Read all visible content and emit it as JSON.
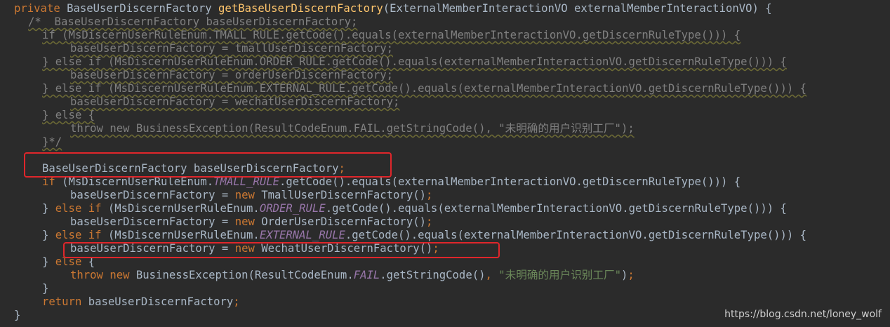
{
  "editor": {
    "language": "java",
    "theme": "darcula",
    "colors": {
      "background": "#2b2b2b",
      "keyword": "#cc7832",
      "method_declaration": "#ffc66d",
      "static_field": "#9876aa",
      "string": "#6a8759",
      "comment": "#808080",
      "plain": "#a9b7c6",
      "annotation_box": "#e0262b"
    },
    "lines": [
      {
        "indent": 1,
        "tokens": [
          [
            "kw",
            "private "
          ],
          [
            "text",
            "BaseUserDiscernFactory "
          ],
          [
            "fn",
            "getBaseUserDiscernFactory"
          ],
          [
            "text",
            "(ExternalMemberInteractionVO externalMemberInteractionVO) {"
          ]
        ]
      },
      {
        "indent": 2,
        "tokens": [
          [
            "cmt",
            "/*  BaseUserDiscernFactory baseUserDiscernFactory;"
          ]
        ]
      },
      {
        "indent": 3,
        "tokens": [
          [
            "cmt",
            "if (MsDiscernUserRuleEnum.TMALL_RULE.getCode().equals(externalMemberInteractionVO.getDiscernRuleType())) {"
          ]
        ]
      },
      {
        "indent": 5,
        "tokens": [
          [
            "cmt",
            "baseUserDiscernFactory = tmallUserDiscernFactory;"
          ]
        ]
      },
      {
        "indent": 3,
        "tokens": [
          [
            "cmt",
            "} else if (MsDiscernUserRuleEnum.ORDER_RULE.getCode().equals(externalMemberInteractionVO.getDiscernRuleType())) {"
          ]
        ]
      },
      {
        "indent": 5,
        "tokens": [
          [
            "cmt",
            "baseUserDiscernFactory = orderUserDiscernFactory;"
          ]
        ]
      },
      {
        "indent": 3,
        "tokens": [
          [
            "cmt",
            "} else if (MsDiscernUserRuleEnum.EXTERNAL_RULE.getCode().equals(externalMemberInteractionVO.getDiscernRuleType())) {"
          ]
        ]
      },
      {
        "indent": 5,
        "tokens": [
          [
            "cmt",
            "baseUserDiscernFactory = wechatUserDiscernFactory;"
          ]
        ]
      },
      {
        "indent": 3,
        "tokens": [
          [
            "cmt",
            "} else {"
          ]
        ]
      },
      {
        "indent": 5,
        "tokens": [
          [
            "cmt",
            "throw new BusinessException(ResultCodeEnum.FAIL.getStringCode(), \"未明确的用户识别工厂\");"
          ]
        ]
      },
      {
        "indent": 3,
        "tokens": [
          [
            "cmt",
            "}*/"
          ]
        ]
      },
      {
        "indent": 0,
        "tokens": []
      },
      {
        "indent": 3,
        "tokens": [
          [
            "text",
            "BaseUserDiscernFactory baseUserDiscernFactory"
          ],
          [
            "kw",
            ";"
          ]
        ]
      },
      {
        "indent": 3,
        "tokens": [
          [
            "kw",
            "if "
          ],
          [
            "text",
            "(MsDiscernUserRuleEnum."
          ],
          [
            "field",
            "TMALL_RULE"
          ],
          [
            "text",
            ".getCode().equals(externalMemberInteractionVO.getDiscernRuleType())) {"
          ]
        ]
      },
      {
        "indent": 5,
        "tokens": [
          [
            "text",
            "baseUserDiscernFactory = "
          ],
          [
            "kw",
            "new "
          ],
          [
            "text",
            "TmallUserDiscernFactory()"
          ],
          [
            "kw",
            ";"
          ]
        ]
      },
      {
        "indent": 3,
        "tokens": [
          [
            "text",
            "} "
          ],
          [
            "kw",
            "else if "
          ],
          [
            "text",
            "(MsDiscernUserRuleEnum."
          ],
          [
            "field",
            "ORDER_RULE"
          ],
          [
            "text",
            ".getCode().equals(externalMemberInteractionVO.getDiscernRuleType())) {"
          ]
        ]
      },
      {
        "indent": 5,
        "tokens": [
          [
            "text",
            "baseUserDiscernFactory = "
          ],
          [
            "kw",
            "new "
          ],
          [
            "text",
            "OrderUserDiscernFactory()"
          ],
          [
            "kw",
            ";"
          ]
        ]
      },
      {
        "indent": 3,
        "tokens": [
          [
            "text",
            "} "
          ],
          [
            "kw",
            "else if "
          ],
          [
            "text",
            "(MsDiscernUserRuleEnum."
          ],
          [
            "field",
            "EXTERNAL_RULE"
          ],
          [
            "text",
            ".getCode().equals(externalMemberInteractionVO.getDiscernRuleType())) {"
          ]
        ]
      },
      {
        "indent": 5,
        "tokens": [
          [
            "text",
            "baseUserDiscernFactory = "
          ],
          [
            "kw",
            "new "
          ],
          [
            "text",
            "WechatUserDiscernFactory()"
          ],
          [
            "kw",
            ";"
          ]
        ]
      },
      {
        "indent": 3,
        "tokens": [
          [
            "text",
            "} "
          ],
          [
            "kw",
            "else "
          ],
          [
            "text",
            "{"
          ]
        ]
      },
      {
        "indent": 5,
        "tokens": [
          [
            "kw",
            "throw new "
          ],
          [
            "text",
            "BusinessException(ResultCodeEnum."
          ],
          [
            "field",
            "FAIL"
          ],
          [
            "text",
            ".getStringCode()"
          ],
          [
            "kw",
            ", "
          ],
          [
            "str",
            "\"未明确的用户识别工厂\""
          ],
          [
            "text",
            ")"
          ],
          [
            "kw",
            ";"
          ]
        ]
      },
      {
        "indent": 3,
        "tokens": [
          [
            "text",
            "}"
          ]
        ]
      },
      {
        "indent": 3,
        "tokens": [
          [
            "kw",
            "return "
          ],
          [
            "text",
            "baseUserDiscernFactory"
          ],
          [
            "kw",
            ";"
          ]
        ]
      },
      {
        "indent": 1,
        "tokens": [
          [
            "text",
            "}"
          ]
        ]
      }
    ]
  },
  "watermark": "https://blog.csdn.net/loney_wolf"
}
